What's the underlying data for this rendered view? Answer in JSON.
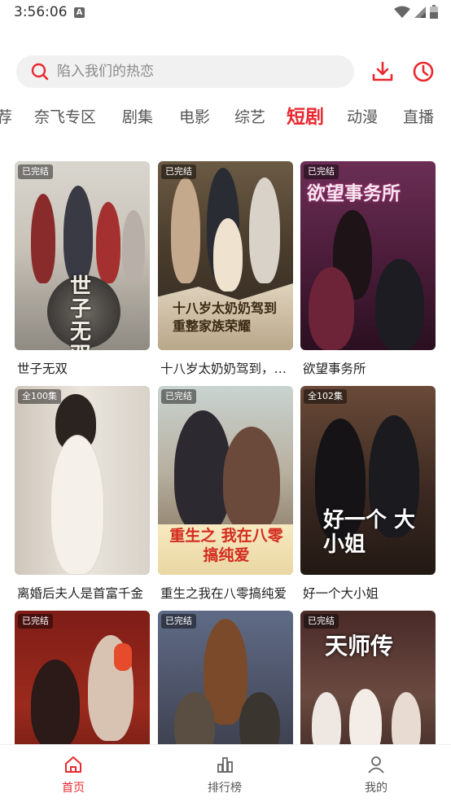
{
  "status": {
    "time": "3:56:06",
    "notification_letter": "A"
  },
  "search": {
    "placeholder": "陷入我们的热恋"
  },
  "header_icons": {
    "download": "download-icon",
    "history": "clock-icon"
  },
  "accent_color": "#e8292f",
  "tabs": [
    {
      "label": "荐"
    },
    {
      "label": "奈飞专区"
    },
    {
      "label": "剧集"
    },
    {
      "label": "电影"
    },
    {
      "label": "综艺"
    },
    {
      "label": "短剧",
      "active": true
    },
    {
      "label": "动漫"
    },
    {
      "label": "直播"
    }
  ],
  "cards": [
    {
      "badge": "已完结",
      "title": "世子无双",
      "poster_text": "世子无双"
    },
    {
      "badge": "已完结",
      "title": "十八岁太奶奶驾到，重整家族荣耀",
      "poster_text": "十八岁太奶奶驾到 重整家族荣耀"
    },
    {
      "badge": "已完结",
      "title": "欲望事务所",
      "poster_text": "欲望事务所"
    },
    {
      "badge": "全100集",
      "title": "离婚后夫人是首富千金",
      "poster_text": ""
    },
    {
      "badge": "已完结",
      "title": "重生之我在八零搞纯爱",
      "poster_text": "重生之 我在八零搞纯爱"
    },
    {
      "badge": "全102集",
      "title": "好一个大小姐",
      "poster_text": "好一个 大小姐"
    },
    {
      "badge": "已完结",
      "title": "",
      "poster_text": ""
    },
    {
      "badge": "已完结",
      "title": "",
      "poster_text": ""
    },
    {
      "badge": "已完结",
      "title": "",
      "poster_text": "天师传"
    }
  ],
  "bottom_nav": [
    {
      "label": "首页",
      "icon": "home-icon",
      "active": true
    },
    {
      "label": "排行榜",
      "icon": "bar-chart-icon"
    },
    {
      "label": "我的",
      "icon": "user-icon"
    }
  ]
}
